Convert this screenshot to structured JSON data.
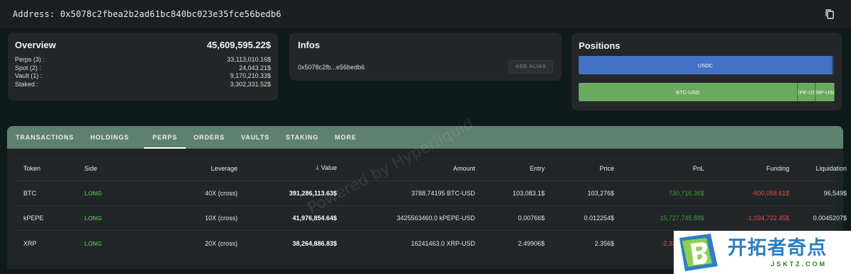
{
  "address": {
    "label": "Address: 0x5078c2fbea2b2ad61bc840bc023e35fce56bedb6"
  },
  "overview": {
    "title": "Overview",
    "total": "45,609,595.22$",
    "rows": [
      {
        "name": "Perps",
        "count": "3",
        "value": "33,113,010.16$"
      },
      {
        "name": "Spot",
        "count": "2",
        "value": "24,043.21$"
      },
      {
        "name": "Vault",
        "count": "1",
        "value": "9,170,210.33$"
      },
      {
        "name": "Staked",
        "count": "",
        "value": "3,302,331.52$"
      }
    ],
    "row_labels": [
      "Perps (3) :",
      "Spot (2) :",
      "Vault (1) :",
      "Staked :"
    ]
  },
  "infos": {
    "title": "Infos",
    "short_address": "0x5078c2fb...e56bedb6",
    "alias_button": "ADD ALIAS"
  },
  "positions": {
    "title": "Positions",
    "spot_bar": [
      {
        "label": "USDC",
        "share": 0.995,
        "color": "#4473c5"
      }
    ],
    "perp_bar": [
      {
        "label": "BTC-USD",
        "share": 0.855,
        "color": "#6aaa5e"
      },
      {
        "label": "PEPE-USD",
        "share": 0.07,
        "color": "#6aaa5e"
      },
      {
        "label": "XRP-USD",
        "share": 0.075,
        "color": "#6aaa5e"
      }
    ]
  },
  "tabs": {
    "items": [
      "TRANSACTIONS",
      "HOLDINGS",
      "PERPS",
      "ORDERS",
      "VAULTS",
      "STAKING",
      "MORE"
    ],
    "active": "PERPS"
  },
  "table": {
    "headers": [
      "Token",
      "Side",
      "Leverage",
      "Value",
      "Amount",
      "Entry",
      "Price",
      "PnL",
      "Funding",
      "Liquidation"
    ],
    "sorted_by": "Value",
    "rows": [
      {
        "token": "BTC",
        "side": "LONG",
        "leverage": "40X (cross)",
        "value": "391,286,113.63$",
        "amount": "3788.74195 BTC-USD",
        "entry": "103,083.1$",
        "price": "103,276$",
        "pnl": "730,716.36$",
        "funding": "-600,058.61$",
        "liquidation": "96,549$"
      },
      {
        "token": "kPEPE",
        "side": "LONG",
        "leverage": "10X (cross)",
        "value": "41,976,854.64$",
        "amount": "3425563460.0 kPEPE-USD",
        "entry": "0.00766$",
        "price": "0.012254$",
        "pnl": "15,727,745.88$",
        "funding": "-1,034,722.45$",
        "liquidation": "0.0045207$"
      },
      {
        "token": "XRP",
        "side": "LONG",
        "leverage": "20X (cross)",
        "value": "38,264,886.83$",
        "amount": "16241463.0 XRP-USD",
        "entry": "2.49906$",
        "price": "2.356$",
        "pnl": "-2,323,475.04$",
        "funding": "",
        "liquidation": ""
      }
    ],
    "watermark": "Powered by Hyperliquid"
  },
  "badge": {
    "name_cn": "开拓者奇点",
    "domain": "JSKTZ.COM"
  },
  "colors": {
    "background": "#0f1a1a",
    "card": "#242728",
    "tab_bar": "#5e8070",
    "long": "#4fa34a",
    "positive": "#3f9a3f",
    "negative": "#e04b4b",
    "usdc_bar": "#4473c5",
    "perp_bar": "#6aaa5e"
  }
}
